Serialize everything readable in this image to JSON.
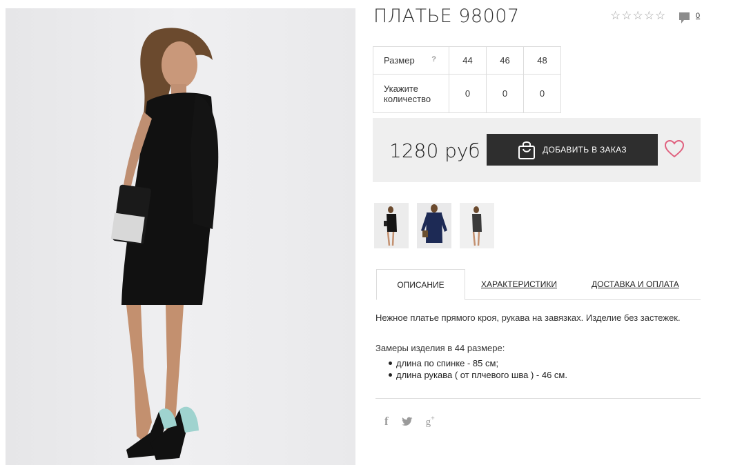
{
  "product": {
    "title": "ПЛАТЬЕ 98007",
    "rating_icon": "star-outline-icon",
    "rating_stars": 0,
    "rating_max": 5,
    "comments_count": "0"
  },
  "sizes": {
    "size_label": "Размер",
    "help_label": "?",
    "qty_label_line1": "Укажите",
    "qty_label_line2": "количество",
    "columns": [
      {
        "size": "44",
        "qty": "0"
      },
      {
        "size": "46",
        "qty": "0"
      },
      {
        "size": "48",
        "qty": "0"
      }
    ]
  },
  "purchase": {
    "price": "1280 руб",
    "add_button_label": "ДОБАВИТЬ В ЗАКАЗ",
    "add_button_icon": "shopping-bag-icon",
    "wishlist_icon": "heart-icon",
    "accent_color": "#e0607e",
    "button_color": "#2e2e2e"
  },
  "gallery": {
    "thumbnail_count": 3
  },
  "tabs": [
    {
      "label": "ОПИСАНИЕ",
      "active": true
    },
    {
      "label": "ХАРАКТЕРИСТИКИ",
      "active": false
    },
    {
      "label": "ДОСТАВКА И ОПЛАТА",
      "active": false
    }
  ],
  "description": {
    "text": "Нежное платье прямого кроя, рукава на завязках. Изделие без застежек.",
    "measures_title": "Замеры изделия в 44 размере:",
    "measures": [
      "длина по спинке - 85 см;",
      "длина рукава ( от плчевого шва ) - 46 см."
    ]
  },
  "social": {
    "facebook": "f",
    "twitter_icon": "twitter-icon",
    "google_plus": "g",
    "google_plus_sup": "+"
  }
}
